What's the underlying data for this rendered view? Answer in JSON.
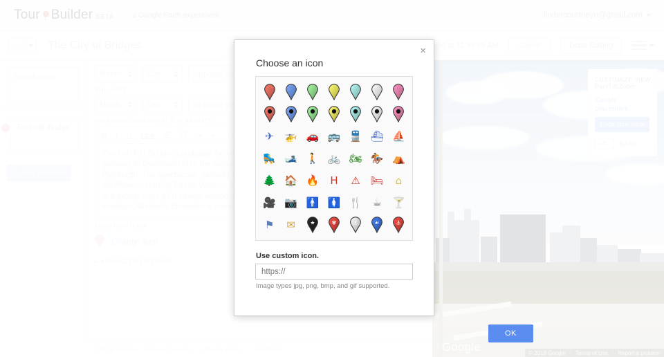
{
  "brand": {
    "name_part1": "Tour",
    "name_part2": "Builder",
    "beta": "BETA",
    "tagline": "a Google Earth experiment",
    "account_email": "lindercourtneyn@gmail.com"
  },
  "toolbar": {
    "doc_title": "The City of Bridges",
    "saved_at": "Saved at 11:46:45 AM",
    "saved_label": "Saved",
    "done_editing_label": "Done Editing"
  },
  "sidebar": {
    "intro_card_label": "Introduction",
    "location_card_label": "Fort Pitt Bridge",
    "add_location_label": "Add Location",
    "add_location_plus": "+"
  },
  "editor": {
    "start_month": "Month",
    "start_day": "Day",
    "start_year_placeholder": "optional year",
    "end_date_label": "END DATE",
    "end_month": "Month",
    "end_day": "Day",
    "end_year_placeholder": "optional year",
    "intro_label": "INTRODUCTION (WHAT'S IT ABOUT?)",
    "toolbar_buttons": [
      "B",
      "I",
      "U",
      "Link"
    ],
    "body_text": "The Fort Pitt Bridge is probably the city's most famous bridge, given that it's not only the gateway to Downtown from the airport, but also a focal point of many films built in Pittsburgh. The spectacular gateway to the city is highlighted in \"The Perks of Being a Wallflower,\" starring Emma Watson. In the film, Watson's character stands up in the back of a pickup truck as it travels eastbound through the Fort Pitt Tunnel. When the truck emerges, Watson's character is enveloped in the warm embrace of this view at night.",
    "location_icon_label": "LOCATION ICON",
    "change_icon_label": "Change Icon",
    "advanced_options_label": "ADVANCED OPTIONS"
  },
  "map": {
    "customize_view_title": "CUSTOMIZE VIEW",
    "customize_view_sub": "Pan/Tilt/Zoom",
    "center_placemark_label": "Center placemark",
    "lock_view_label": "Lock this view",
    "back_label": "BACK",
    "watermark": "Google",
    "attrib_copyright": "© 2019 Google",
    "attrib_terms": "Terms of Use",
    "attrib_report": "Report a problem"
  },
  "footer": {
    "copyright": "© 2018 Google",
    "links": [
      "Terms of Service",
      "Privacy Policy",
      "Feedback"
    ],
    "separator": "·"
  },
  "modal": {
    "title": "Choose an icon",
    "close_label": "×",
    "custom_icon_label": "Use custom icon.",
    "url_value": "https://",
    "hint": "Image types jpg, png, bmp, and gif supported.",
    "ok_label": "OK",
    "icons": [
      {
        "name": "pin-red",
        "type": "pin",
        "color": "#e8695c",
        "dot": false
      },
      {
        "name": "pin-blue",
        "type": "pin",
        "color": "#6b93ea",
        "dot": false
      },
      {
        "name": "pin-green",
        "type": "pin",
        "color": "#8ee08a",
        "dot": false
      },
      {
        "name": "pin-yellow",
        "type": "pin",
        "color": "#f3e95e",
        "dot": false
      },
      {
        "name": "pin-cyan",
        "type": "pin",
        "color": "#9fead9",
        "dot": false
      },
      {
        "name": "pin-white",
        "type": "pin",
        "color": "#ffffff",
        "dot": false
      },
      {
        "name": "pin-pink",
        "type": "pin",
        "color": "#ef80ab",
        "dot": false
      },
      {
        "name": "pin-dot-red",
        "type": "pin",
        "color": "#e8695c",
        "dot": true
      },
      {
        "name": "pin-dot-blue",
        "type": "pin",
        "color": "#6b93ea",
        "dot": true
      },
      {
        "name": "pin-dot-green",
        "type": "pin",
        "color": "#8ee08a",
        "dot": true
      },
      {
        "name": "pin-dot-yellow",
        "type": "pin",
        "color": "#f3e95e",
        "dot": true
      },
      {
        "name": "pin-dot-cyan",
        "type": "pin",
        "color": "#9fead9",
        "dot": true
      },
      {
        "name": "pin-dot-white",
        "type": "pin",
        "color": "#ffffff",
        "dot": true
      },
      {
        "name": "pin-dot-pink",
        "type": "pin",
        "color": "#ef80ab",
        "dot": true
      },
      {
        "name": "airplane-icon",
        "type": "glyph",
        "glyph": "✈",
        "color": "#4a6fc4"
      },
      {
        "name": "helicopter-icon",
        "type": "glyph",
        "glyph": "🚁",
        "color": "#4a6fc4"
      },
      {
        "name": "car-icon",
        "type": "glyph",
        "glyph": "🚗",
        "color": "#4a6fc4"
      },
      {
        "name": "bus-icon",
        "type": "glyph",
        "glyph": "🚌",
        "color": "#4a6fc4"
      },
      {
        "name": "train-icon",
        "type": "glyph",
        "glyph": "🚆",
        "color": "#4a6fc4"
      },
      {
        "name": "ferry-icon",
        "type": "glyph",
        "glyph": "⛴",
        "color": "#4a6fc4"
      },
      {
        "name": "sailboat-icon",
        "type": "glyph",
        "glyph": "⛵",
        "color": "#4a6fc4"
      },
      {
        "name": "rollerblade-icon",
        "type": "glyph",
        "glyph": "🛼",
        "color": "#4a6fc4"
      },
      {
        "name": "skiing-icon",
        "type": "glyph",
        "glyph": "🎿",
        "color": "#4a6fc4"
      },
      {
        "name": "hiking-icon",
        "type": "glyph",
        "glyph": "🚶",
        "color": "#4f9b45"
      },
      {
        "name": "bicycle-icon",
        "type": "glyph",
        "glyph": "🚲",
        "color": "#4f9b45"
      },
      {
        "name": "motorcycle-icon",
        "type": "glyph",
        "glyph": "🏍",
        "color": "#4f9b45"
      },
      {
        "name": "horseback-icon",
        "type": "glyph",
        "glyph": "🏇",
        "color": "#4f9b45"
      },
      {
        "name": "campground-icon",
        "type": "glyph",
        "glyph": "⛺",
        "color": "#4f9b45"
      },
      {
        "name": "tree-icon",
        "type": "glyph",
        "glyph": "🌲",
        "color": "#4f9b45"
      },
      {
        "name": "ranger-station-icon",
        "type": "glyph",
        "glyph": "🏠",
        "color": "#4f9b45"
      },
      {
        "name": "campfire-icon",
        "type": "glyph",
        "glyph": "🔥",
        "color": "#cf3b2e"
      },
      {
        "name": "hospital-icon",
        "type": "glyph",
        "glyph": "H",
        "color": "#cf3b2e"
      },
      {
        "name": "warning-icon",
        "type": "glyph",
        "glyph": "⚠",
        "color": "#cf3b2e"
      },
      {
        "name": "lodging-icon",
        "type": "glyph",
        "glyph": "🛏",
        "color": "#cf3b2e"
      },
      {
        "name": "home-icon",
        "type": "glyph",
        "glyph": "⌂",
        "color": "#d8c23c"
      },
      {
        "name": "movie-camera-icon",
        "type": "glyph",
        "glyph": "🎥",
        "color": "#d8c23c"
      },
      {
        "name": "photo-camera-icon",
        "type": "glyph",
        "glyph": "📷",
        "color": "#a057b5"
      },
      {
        "name": "man-icon",
        "type": "glyph",
        "glyph": "🚹",
        "color": "#9a9a9a"
      },
      {
        "name": "woman-icon",
        "type": "glyph",
        "glyph": "🚺",
        "color": "#9a9a9a"
      },
      {
        "name": "restaurant-icon",
        "type": "glyph",
        "glyph": "🍴",
        "color": "#7a7a7a"
      },
      {
        "name": "coffee-icon",
        "type": "glyph",
        "glyph": "☕",
        "color": "#7a7a7a"
      },
      {
        "name": "cocktail-icon",
        "type": "glyph",
        "glyph": "🍸",
        "color": "#7a7a7a"
      },
      {
        "name": "flag-icon",
        "type": "glyph",
        "glyph": "⚑",
        "color": "#5c7fb8"
      },
      {
        "name": "envelope-icon",
        "type": "glyph",
        "glyph": "✉",
        "color": "#d8a33c"
      },
      {
        "name": "pin-star-icon",
        "type": "pin",
        "color": "#222222",
        "dot": false,
        "badge": "★"
      },
      {
        "name": "pin-flower-icon",
        "type": "pin",
        "color": "#d8423a",
        "dot": false,
        "badge": "✾"
      },
      {
        "name": "pin-anchor-silver-icon",
        "type": "pin",
        "color": "#e8e8e8",
        "dot": false,
        "badge": "⚓"
      },
      {
        "name": "pin-shell-blue-icon",
        "type": "pin",
        "color": "#3b6fd4",
        "dot": false,
        "badge": "☙"
      },
      {
        "name": "pin-anchor-red-icon",
        "type": "pin",
        "color": "#d8423a",
        "dot": false,
        "badge": "⚓"
      }
    ]
  }
}
